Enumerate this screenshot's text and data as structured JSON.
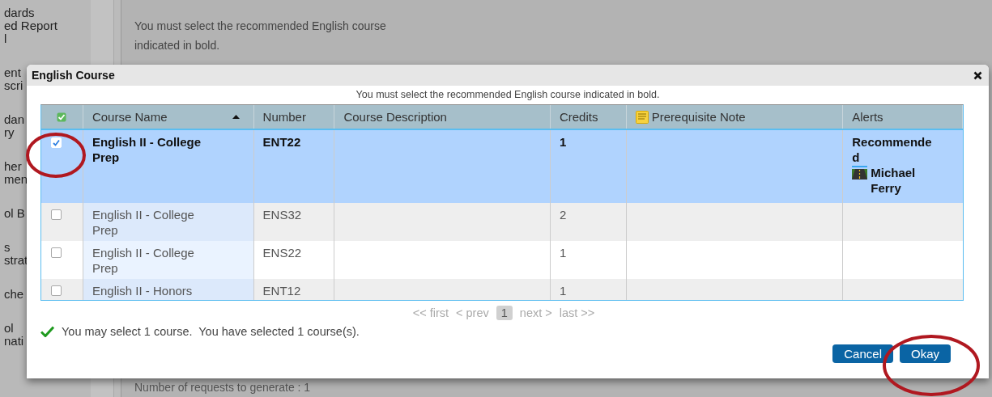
{
  "background": {
    "sidebar_items": [
      {
        "lines": [
          "dards",
          "ed Report",
          "l"
        ]
      },
      {
        "lines": [
          "ent",
          "scri"
        ]
      },
      {
        "lines": [
          "dan",
          "ry"
        ]
      },
      {
        "lines": [
          "her",
          "men"
        ]
      },
      {
        "lines": [
          "ol B"
        ]
      },
      {
        "lines": [
          "s",
          "strat"
        ]
      },
      {
        "lines": [
          "che"
        ]
      },
      {
        "lines": [
          "ol",
          "nati"
        ]
      }
    ],
    "message": "You must select the recommended English course indicated in bold.",
    "requests_line": "Number of requests to generate : 1"
  },
  "dialog": {
    "title": "English Course",
    "message": "You must select the recommended English course indicated in bold.",
    "table": {
      "columns": [
        {
          "kind": "select"
        },
        {
          "kind": "text",
          "label": "Course Name",
          "sorted": true
        },
        {
          "kind": "text",
          "label": "Number",
          "sorted": false
        },
        {
          "kind": "text",
          "label": "Course Description",
          "sorted": false
        },
        {
          "kind": "text",
          "label": "Credits",
          "sorted": false
        },
        {
          "kind": "note",
          "label": "Prerequisite Note",
          "sorted": false
        },
        {
          "kind": "text",
          "label": "Alerts",
          "sorted": false
        }
      ],
      "rows": [
        {
          "checked": true,
          "selected": true,
          "recommended": true,
          "name": "English II - College Prep",
          "number": "ENT22",
          "credits": "1",
          "alerts": [
            {
              "kind": "text",
              "text": "Recommended"
            },
            {
              "kind": "person",
              "text": "Michael Ferry"
            }
          ]
        },
        {
          "checked": false,
          "selected": false,
          "recommended": false,
          "name": "English II - College Prep",
          "number": "ENS32",
          "credits": "2"
        },
        {
          "checked": false,
          "selected": false,
          "recommended": false,
          "name": "English II - College Prep",
          "number": "ENS22",
          "credits": "1"
        },
        {
          "checked": false,
          "selected": false,
          "recommended": false,
          "name": "English II - Honors",
          "number": "ENT12",
          "credits": "1"
        }
      ]
    },
    "pager": {
      "first": "<< first",
      "prev": "< prev",
      "pages": [
        {
          "label": "1",
          "selected": true
        }
      ],
      "next": "next >",
      "last": "last >>"
    },
    "status": {
      "ok": true,
      "text": "You may select 1 course.  You have selected 1 course(s)."
    },
    "buttons": [
      {
        "label": "Cancel"
      },
      {
        "label": "Okay"
      }
    ]
  }
}
